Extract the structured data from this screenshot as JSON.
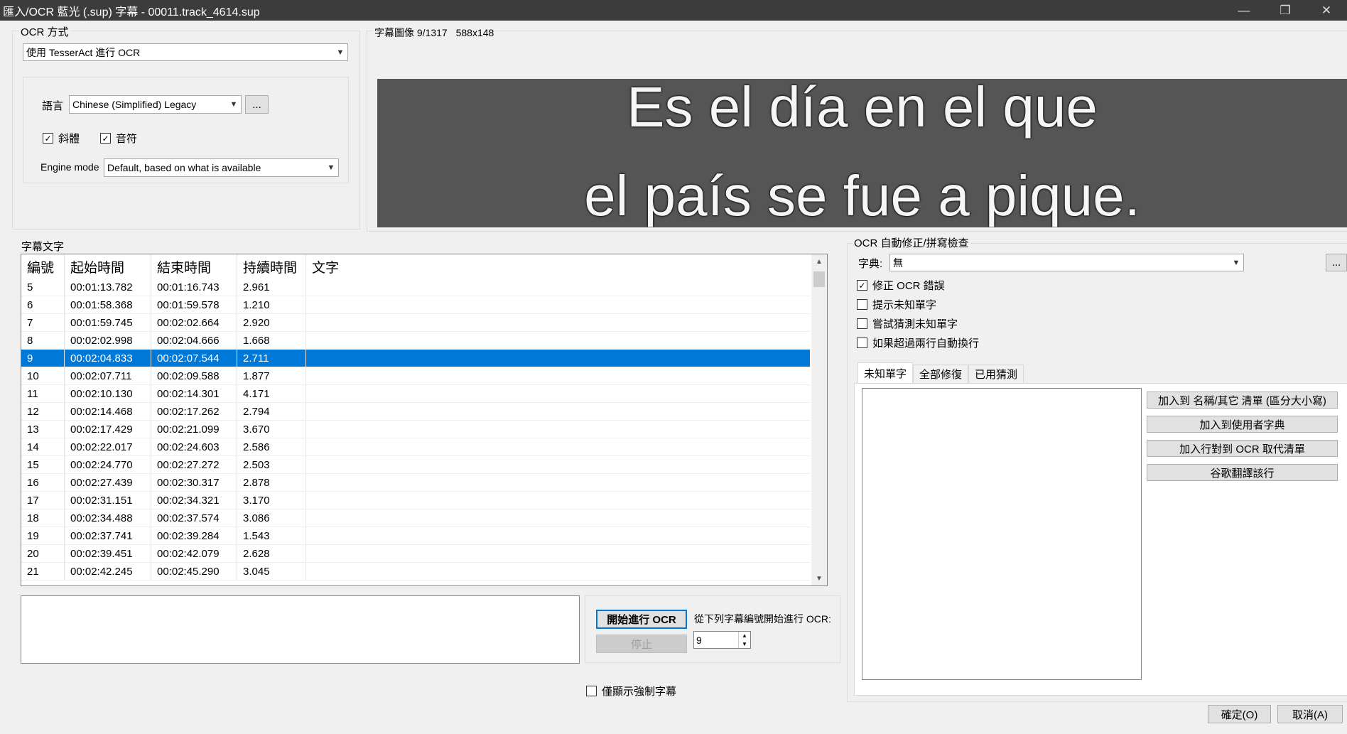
{
  "window": {
    "title": "匯入/OCR 藍光 (.sup) 字幕 - 00011.track_4614.sup",
    "minimize_glyph": "—",
    "restore_glyph": "❐",
    "close_glyph": "✕"
  },
  "ocr_method": {
    "label": "OCR 方式",
    "value": "使用 TesserAct 進行 OCR",
    "language_label": "語言",
    "language_value": "Chinese (Simplified) Legacy",
    "more_button": "...",
    "italic_label": "斜體",
    "italic_checked": true,
    "diacritics_label": "音符",
    "diacritics_checked": true,
    "engine_label": "Engine mode",
    "engine_value": "Default, based on what is available"
  },
  "preview": {
    "label": "字幕圖像 9/1317",
    "size": "588x148",
    "line1": "Es el día en el que",
    "line2": "el país se fue a pique."
  },
  "subtitle_text": {
    "label": "字幕文字",
    "columns": [
      "編號",
      "起始時間",
      "結束時間",
      "持續時間",
      "文字"
    ],
    "selected_index": 4,
    "rows": [
      [
        "5",
        "00:01:13.782",
        "00:01:16.743",
        "2.961",
        ""
      ],
      [
        "6",
        "00:01:58.368",
        "00:01:59.578",
        "1.210",
        ""
      ],
      [
        "7",
        "00:01:59.745",
        "00:02:02.664",
        "2.920",
        ""
      ],
      [
        "8",
        "00:02:02.998",
        "00:02:04.666",
        "1.668",
        ""
      ],
      [
        "9",
        "00:02:04.833",
        "00:02:07.544",
        "2.711",
        ""
      ],
      [
        "10",
        "00:02:07.711",
        "00:02:09.588",
        "1.877",
        ""
      ],
      [
        "11",
        "00:02:10.130",
        "00:02:14.301",
        "4.171",
        ""
      ],
      [
        "12",
        "00:02:14.468",
        "00:02:17.262",
        "2.794",
        ""
      ],
      [
        "13",
        "00:02:17.429",
        "00:02:21.099",
        "3.670",
        ""
      ],
      [
        "14",
        "00:02:22.017",
        "00:02:24.603",
        "2.586",
        ""
      ],
      [
        "15",
        "00:02:24.770",
        "00:02:27.272",
        "2.503",
        ""
      ],
      [
        "16",
        "00:02:27.439",
        "00:02:30.317",
        "2.878",
        ""
      ],
      [
        "17",
        "00:02:31.151",
        "00:02:34.321",
        "3.170",
        ""
      ],
      [
        "18",
        "00:02:34.488",
        "00:02:37.574",
        "3.086",
        ""
      ],
      [
        "19",
        "00:02:37.741",
        "00:02:39.284",
        "1.543",
        ""
      ],
      [
        "20",
        "00:02:39.451",
        "00:02:42.079",
        "2.628",
        ""
      ],
      [
        "21",
        "00:02:42.245",
        "00:02:45.290",
        "3.045",
        ""
      ]
    ]
  },
  "ocr_controls": {
    "start_button": "開始進行 OCR",
    "stop_button": "停止",
    "start_from_label": "從下列字幕編號開始進行 OCR:",
    "start_from_value": "9",
    "forced_only_label": "僅顯示強制字幕",
    "forced_only_checked": false
  },
  "autocorrect": {
    "label": "OCR 自動修正/拼寫檢查",
    "dictionary_label": "字典:",
    "dictionary_value": "無",
    "more_button": "...",
    "fix_ocr_label": "修正 OCR 錯誤",
    "fix_ocr_checked": true,
    "prompt_unknown_label": "提示未知單字",
    "prompt_unknown_checked": false,
    "guess_unknown_label": "嘗試猜測未知單字",
    "guess_unknown_checked": false,
    "auto_break_label": "如果超過兩行自動換行",
    "auto_break_checked": false,
    "tabs": [
      "未知單字",
      "全部修復",
      "已用猜測"
    ],
    "active_tab": 0,
    "buttons": [
      "加入到 名稱/其它 清單 (區分大小寫)",
      "加入到使用者字典",
      "加入行對到 OCR 取代清單",
      "谷歌翻譯該行"
    ]
  },
  "footer": {
    "ok_button": "確定(O)",
    "cancel_button": "取消(A)"
  }
}
